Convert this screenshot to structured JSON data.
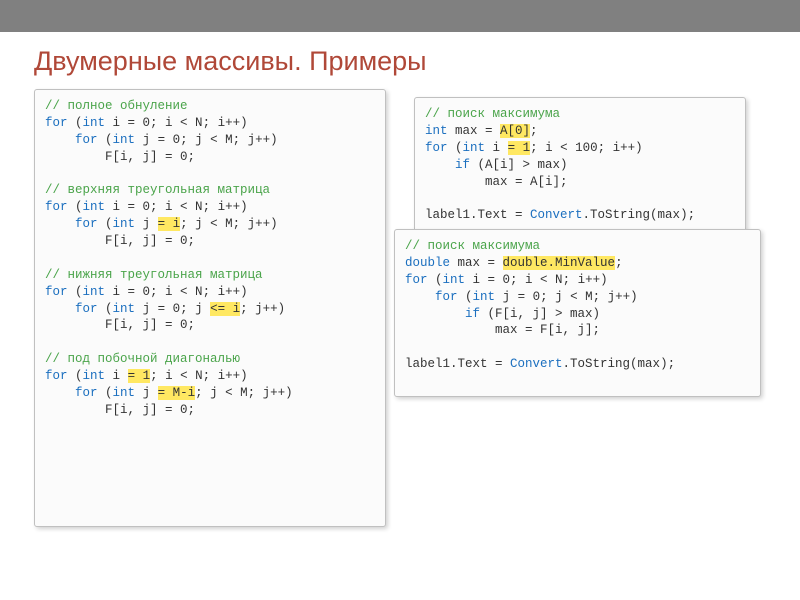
{
  "title": "Двумерные массивы. Примеры",
  "left": {
    "c1": "// полное обнуление",
    "l1a": "for",
    "l1b": "int",
    "l1c": " i = 0; i < N; i++)",
    "l2a": "for",
    "l2b": "int",
    "l2c": " j = 0; j < M; j++)",
    "l3": "        F[i, j] = 0;",
    "c2": "// верхняя треугольная матрица",
    "l4a": "for",
    "l4b": "int",
    "l4c": " i = 0; i < N; i++)",
    "l5a": "for",
    "l5b": "int",
    "l5c": " j ",
    "l5hl": "= i",
    "l5d": "; j < M; j++)",
    "l6": "        F[i, j] = 0;",
    "c3": "// нижняя треугольная матрица",
    "l7a": "for",
    "l7b": "int",
    "l7c": " i = 0; i < N; i++)",
    "l8a": "for",
    "l8b": "int",
    "l8c": " j = 0; j ",
    "l8hl": "<= i",
    "l8d": "; j++)",
    "l9": "        F[i, j] = 0;",
    "c4": "// под побочной диагональю",
    "l10a": "for",
    "l10b": "int",
    "l10c": " i ",
    "l10hl": "= 1",
    "l10d": "; i < N; i++)",
    "l11a": "for",
    "l11b": "int",
    "l11c": " j ",
    "l11hl": "= M-i",
    "l11d": "; j < M; j++)",
    "l12": "        F[i, j] = 0;"
  },
  "r1": {
    "c": "// поиск максимума",
    "l1a": "int",
    "l1b": " max = ",
    "l1hl": "A[0]",
    "l1c": ";",
    "l2a": "for",
    "l2b": "int",
    "l2c": " i ",
    "l2hl": "= 1",
    "l2d": "; i < 100; i++)",
    "l3a": "if",
    "l3b": " (A[i] > max)",
    "l4": "        max = A[i];",
    "l5a": "label1.Text = ",
    "l5b": "Convert",
    "l5c": ".ToString(max);"
  },
  "r2": {
    "c": "// поиск максимума",
    "l1a": "double",
    "l1b": " max = ",
    "l1hl": "double.MinValue",
    "l1c": ";",
    "l2a": "for",
    "l2b": "int",
    "l2c": " i = 0; i < N; i++)",
    "l3a": "for",
    "l3b": "int",
    "l3c": " j = 0; j < M; j++)",
    "l4a": "if",
    "l4b": " (F[i, j] > max)",
    "l5": "            max = F[i, j];",
    "l6a": "label1.Text = ",
    "l6b": "Convert",
    "l6c": ".ToString(max);"
  }
}
